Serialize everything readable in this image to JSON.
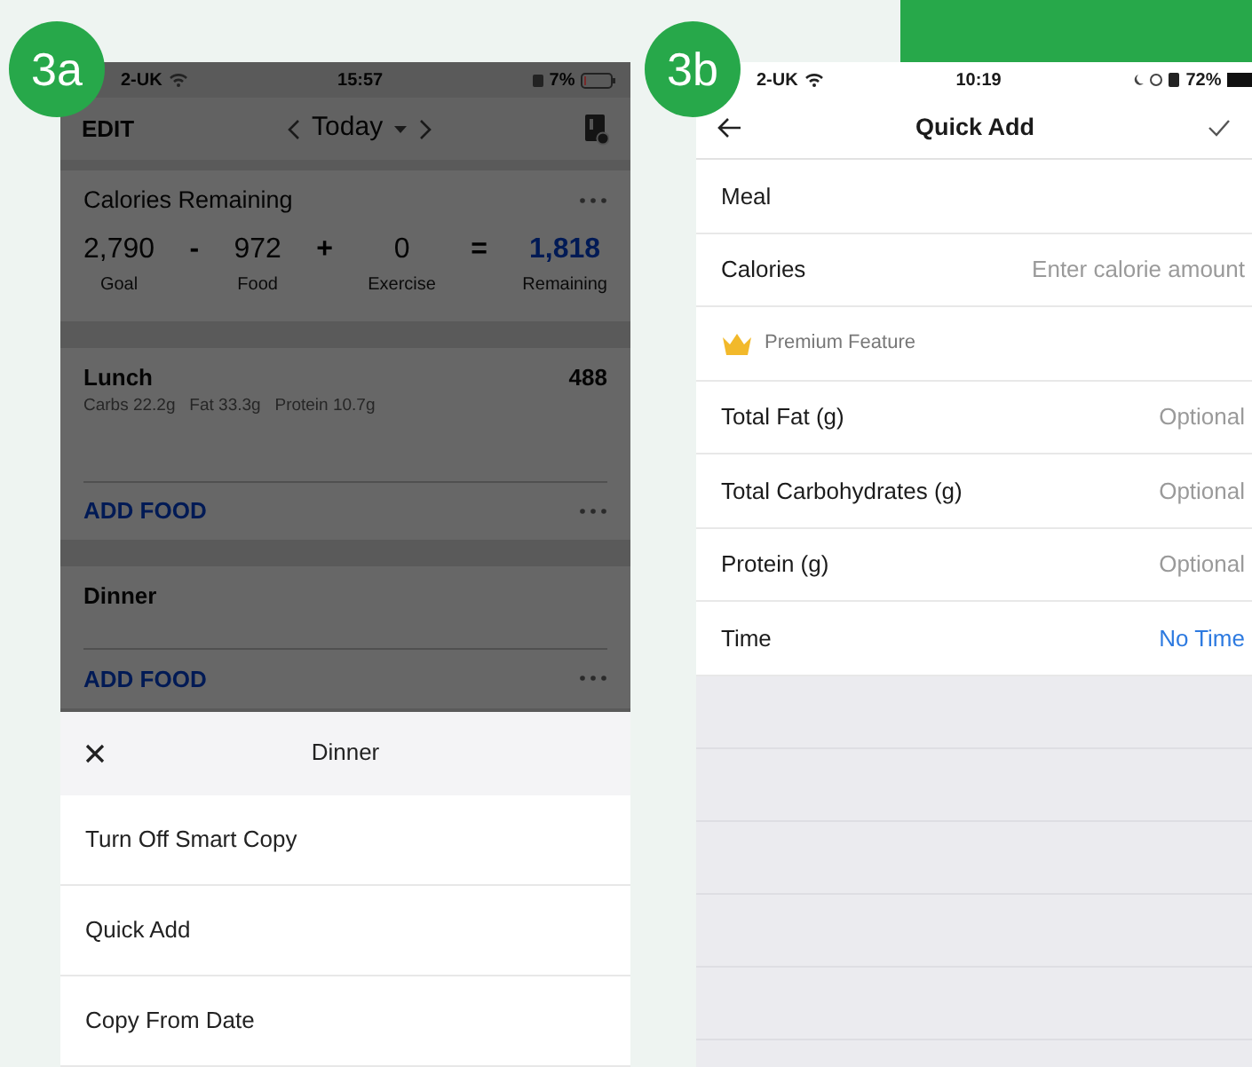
{
  "screen_3a": {
    "badge": "3a",
    "status_bar": {
      "carrier": "2-UK",
      "time": "15:57",
      "battery": "7%"
    },
    "nav": {
      "edit": "EDIT",
      "date": "Today"
    },
    "calories": {
      "title": "Calories Remaining",
      "operators": [
        "-",
        "+",
        "="
      ],
      "terms": [
        {
          "value": "2,790",
          "label": "Goal",
          "highlight": false
        },
        {
          "value": "972",
          "label": "Food",
          "highlight": false
        },
        {
          "value": "0",
          "label": "Exercise",
          "highlight": false
        },
        {
          "value": "1,818",
          "label": "Remaining",
          "highlight": true
        }
      ]
    },
    "meals": [
      {
        "name": "Lunch",
        "calories": "488",
        "macros": "Carbs 22.2g   Fat 33.3g   Protein 10.7g",
        "add": "ADD FOOD"
      },
      {
        "name": "Dinner",
        "add": "ADD FOOD"
      }
    ],
    "sheet": {
      "title": "Dinner",
      "items": [
        "Turn Off Smart Copy",
        "Quick Add",
        "Copy From Date"
      ]
    }
  },
  "screen_3b": {
    "badge": "3b",
    "status_bar": {
      "carrier": "2-UK",
      "time": "10:19",
      "battery": "72%"
    },
    "title": "Quick Add",
    "rows": [
      {
        "kind": "plain",
        "label": "Meal"
      },
      {
        "kind": "input",
        "label": "Calories",
        "placeholder": "Enter calorie amount"
      },
      {
        "kind": "premium",
        "label": "Premium Feature"
      },
      {
        "kind": "input",
        "label": "Total Fat (g)",
        "placeholder": "Optional"
      },
      {
        "kind": "input",
        "label": "Total Carbohydrates (g)",
        "placeholder": "Optional"
      },
      {
        "kind": "input",
        "label": "Protein (g)",
        "placeholder": "Optional"
      },
      {
        "kind": "link",
        "label": "Time",
        "value": "No Time"
      }
    ]
  }
}
